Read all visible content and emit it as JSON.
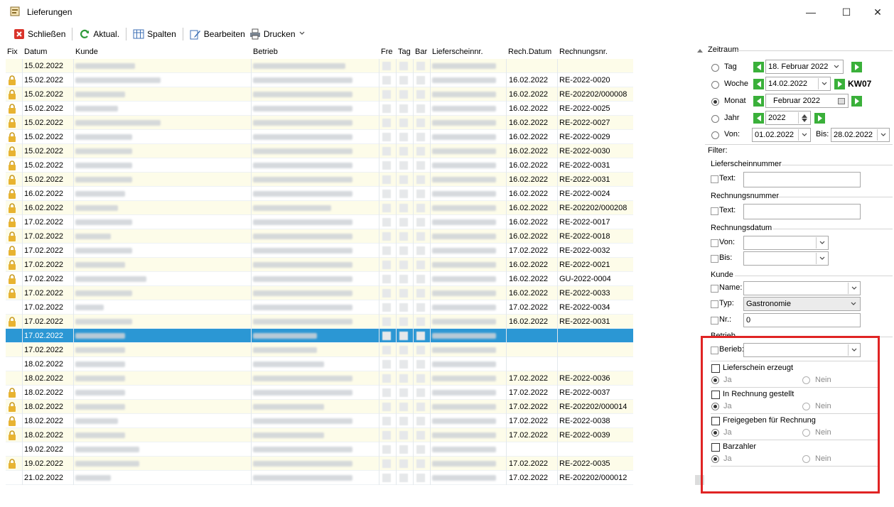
{
  "window": {
    "title": "Lieferungen",
    "minimize_glyph": "—",
    "maximize_glyph": "☐",
    "close_glyph": "✕"
  },
  "toolbar": {
    "close_label": "Schließen",
    "refresh_label": "Aktual.",
    "columns_label": "Spalten",
    "edit_label": "Bearbeiten",
    "print_label": "Drucken"
  },
  "grid": {
    "headers": {
      "fix": "Fix",
      "datum": "Datum",
      "kunde": "Kunde",
      "betrieb": "Betrieb",
      "fre": "Fre",
      "tag": "Tag",
      "bar": "Bar",
      "lieferschein": "Lieferscheinnr.",
      "rech_datum": "Rech.Datum",
      "rechnungsnr": "Rechnungsnr."
    },
    "rows": [
      {
        "locked": false,
        "datum": "15.02.2022",
        "rech_datum": "",
        "rechnungsnr": ""
      },
      {
        "locked": true,
        "datum": "15.02.2022",
        "rech_datum": "16.02.2022",
        "rechnungsnr": "RE-2022-0020"
      },
      {
        "locked": true,
        "datum": "15.02.2022",
        "rech_datum": "16.02.2022",
        "rechnungsnr": "RE-202202/000008"
      },
      {
        "locked": true,
        "datum": "15.02.2022",
        "rech_datum": "16.02.2022",
        "rechnungsnr": "RE-2022-0025"
      },
      {
        "locked": true,
        "datum": "15.02.2022",
        "rech_datum": "16.02.2022",
        "rechnungsnr": "RE-2022-0027"
      },
      {
        "locked": true,
        "datum": "15.02.2022",
        "rech_datum": "16.02.2022",
        "rechnungsnr": "RE-2022-0029"
      },
      {
        "locked": true,
        "datum": "15.02.2022",
        "rech_datum": "16.02.2022",
        "rechnungsnr": "RE-2022-0030"
      },
      {
        "locked": true,
        "datum": "15.02.2022",
        "rech_datum": "16.02.2022",
        "rechnungsnr": "RE-2022-0031"
      },
      {
        "locked": true,
        "datum": "15.02.2022",
        "rech_datum": "16.02.2022",
        "rechnungsnr": "RE-2022-0031"
      },
      {
        "locked": true,
        "datum": "16.02.2022",
        "rech_datum": "16.02.2022",
        "rechnungsnr": "RE-2022-0024"
      },
      {
        "locked": true,
        "datum": "16.02.2022",
        "rech_datum": "16.02.2022",
        "rechnungsnr": "RE-202202/000208"
      },
      {
        "locked": true,
        "datum": "17.02.2022",
        "rech_datum": "16.02.2022",
        "rechnungsnr": "RE-2022-0017"
      },
      {
        "locked": true,
        "datum": "17.02.2022",
        "rech_datum": "16.02.2022",
        "rechnungsnr": "RE-2022-0018"
      },
      {
        "locked": true,
        "datum": "17.02.2022",
        "rech_datum": "17.02.2022",
        "rechnungsnr": "RE-2022-0032"
      },
      {
        "locked": true,
        "datum": "17.02.2022",
        "rech_datum": "16.02.2022",
        "rechnungsnr": "RE-2022-0021"
      },
      {
        "locked": true,
        "datum": "17.02.2022",
        "rech_datum": "16.02.2022",
        "rechnungsnr": "GU-2022-0004"
      },
      {
        "locked": true,
        "datum": "17.02.2022",
        "rech_datum": "16.02.2022",
        "rechnungsnr": "RE-2022-0033"
      },
      {
        "locked": false,
        "datum": "17.02.2022",
        "rech_datum": "17.02.2022",
        "rechnungsnr": "RE-2022-0034"
      },
      {
        "locked": true,
        "datum": "17.02.2022",
        "rech_datum": "16.02.2022",
        "rechnungsnr": "RE-2022-0031"
      },
      {
        "locked": false,
        "datum": "17.02.2022",
        "rech_datum": "",
        "rechnungsnr": "",
        "selected": true
      },
      {
        "locked": false,
        "datum": "17.02.2022",
        "rech_datum": "",
        "rechnungsnr": ""
      },
      {
        "locked": false,
        "datum": "18.02.2022",
        "rech_datum": "",
        "rechnungsnr": ""
      },
      {
        "locked": false,
        "datum": "18.02.2022",
        "rech_datum": "17.02.2022",
        "rechnungsnr": "RE-2022-0036"
      },
      {
        "locked": true,
        "datum": "18.02.2022",
        "rech_datum": "17.02.2022",
        "rechnungsnr": "RE-2022-0037"
      },
      {
        "locked": true,
        "datum": "18.02.2022",
        "rech_datum": "17.02.2022",
        "rechnungsnr": "RE-202202/000014"
      },
      {
        "locked": true,
        "datum": "18.02.2022",
        "rech_datum": "17.02.2022",
        "rechnungsnr": "RE-2022-0038"
      },
      {
        "locked": true,
        "datum": "18.02.2022",
        "rech_datum": "17.02.2022",
        "rechnungsnr": "RE-2022-0039"
      },
      {
        "locked": false,
        "datum": "19.02.2022",
        "rech_datum": "",
        "rechnungsnr": ""
      },
      {
        "locked": true,
        "datum": "19.02.2022",
        "rech_datum": "17.02.2022",
        "rechnungsnr": "RE-2022-0035"
      },
      {
        "locked": false,
        "datum": "21.02.2022",
        "rech_datum": "17.02.2022",
        "rechnungsnr": "RE-202202/000012"
      }
    ]
  },
  "zeitraum": {
    "title": "Zeitraum",
    "tag_label": "Tag",
    "tag_value": "18.  Februar   2022",
    "woche_label": "Woche",
    "woche_value": "14.02.2022",
    "kw_label": "KW07",
    "monat_label": "Monat",
    "monat_value": "Februar   2022",
    "jahr_label": "Jahr",
    "jahr_value": "2022",
    "von_label": "Von:",
    "von_value": "01.02.2022",
    "bis_label": "Bis:",
    "bis_value": "28.02.2022",
    "selected": "monat"
  },
  "filter": {
    "title": "Filter:",
    "lieferscheinnummer": {
      "title": "Lieferscheinnummer",
      "text_label": "Text:",
      "text_value": ""
    },
    "rechnungsnummer": {
      "title": "Rechnungsnummer",
      "text_label": "Text:",
      "text_value": ""
    },
    "rechnungsdatum": {
      "title": "Rechnungsdatum",
      "von_label": "Von:",
      "bis_label": "Bis:"
    },
    "kunde": {
      "title": "Kunde",
      "name_label": "Name:",
      "name_value": "",
      "typ_label": "Typ:",
      "typ_value": "Gastronomie",
      "nr_label": "Nr.:",
      "nr_value": "0"
    },
    "betrieb": {
      "title": "Betrieb",
      "label": "Berieb:",
      "value": ""
    },
    "flags": [
      {
        "label": "Lieferschein erzeugt",
        "yes": "Ja",
        "no": "Nein"
      },
      {
        "label": "In Rechnung gestellt",
        "yes": "Ja",
        "no": "Nein"
      },
      {
        "label": "Freigegeben für Rechnung",
        "yes": "Ja",
        "no": "Nein"
      },
      {
        "label": "Barzahler",
        "yes": "Ja",
        "no": "Nein"
      }
    ]
  },
  "colors": {
    "accent_selection": "#2b97d4",
    "highlight_box": "#e02424",
    "nav_green": "#3ab03a",
    "row_alt": "#fdfce9"
  }
}
